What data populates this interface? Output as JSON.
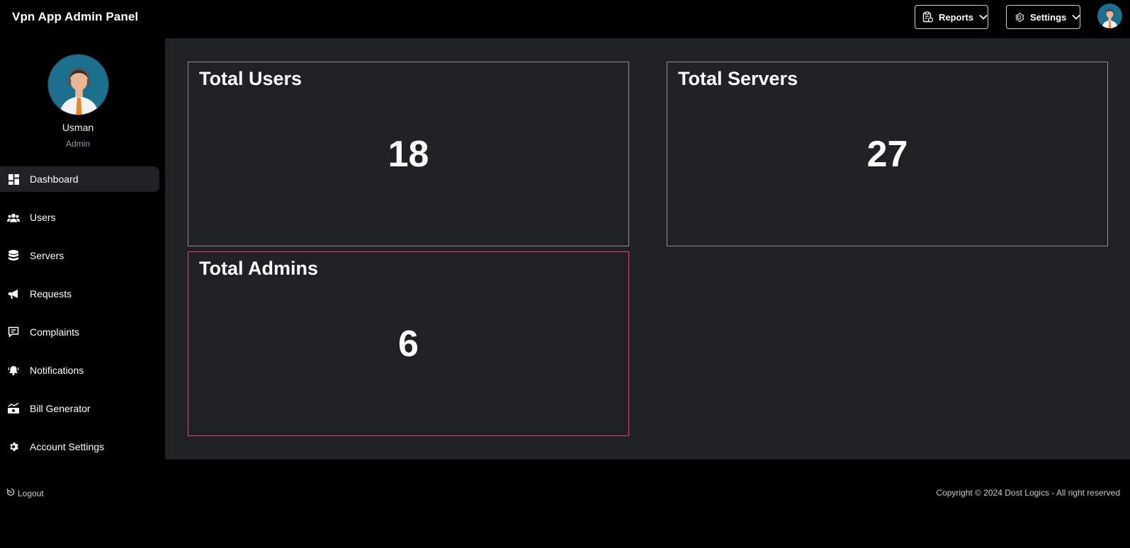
{
  "header": {
    "title": "Vpn App Admin Panel",
    "reports_label": "Reports",
    "settings_label": "Settings"
  },
  "profile": {
    "name": "Usman",
    "role": "Admin"
  },
  "sidebar": {
    "items": [
      {
        "label": "Dashboard",
        "icon": "dashboard-icon",
        "active": true
      },
      {
        "label": "Users",
        "icon": "users-icon"
      },
      {
        "label": "Servers",
        "icon": "database-icon"
      },
      {
        "label": "Requests",
        "icon": "megaphone-icon"
      },
      {
        "label": "Complaints",
        "icon": "comment-alert-icon"
      },
      {
        "label": "Notifications",
        "icon": "bell-ring-icon"
      },
      {
        "label": "Bill Generator",
        "icon": "money-chart-icon"
      },
      {
        "label": "Account Settings",
        "icon": "gear-icon"
      }
    ]
  },
  "cards": [
    {
      "title": "Total Users",
      "value": "18"
    },
    {
      "title": "Total Servers",
      "value": "27"
    },
    {
      "title": "Total Admins",
      "value": "6"
    }
  ],
  "footer": {
    "logout_label": "Logout",
    "copyright": "Copyright © 2024 Dost Logics - All right reserved"
  },
  "colors": {
    "page_bg": "#000000",
    "panel_bg": "#202125",
    "card_border": "#8e8e8e",
    "highlight_border": "#e83e8c",
    "avatar_bg": "#1d6f8f"
  }
}
